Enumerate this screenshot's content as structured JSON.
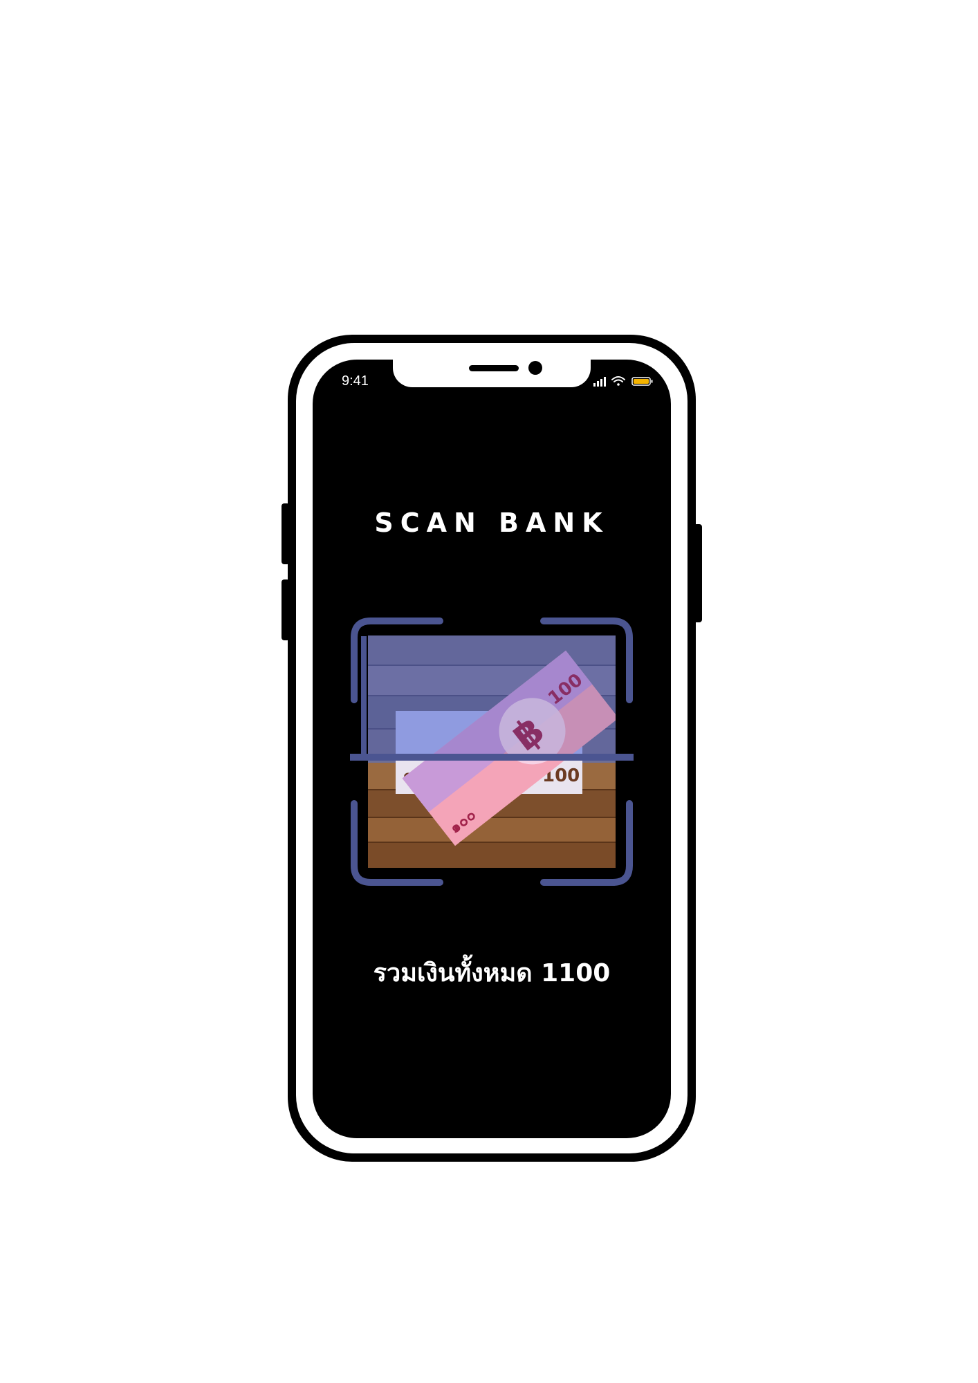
{
  "status_bar": {
    "time": "9:41",
    "icons": [
      "signal-icon",
      "wifi-icon",
      "battery-icon"
    ]
  },
  "app": {
    "title": "SCAN BANK",
    "total_label": "รวมเงินทั้งหมด 1100"
  },
  "scanner": {
    "frame_color": "#4b5591",
    "scan_line_color": "#4b5591",
    "banknote_values": [
      "100",
      "๑๐๐",
      "฿"
    ]
  },
  "colors": {
    "background": "#000000",
    "text": "#ffffff",
    "battery": "#f5b400"
  }
}
